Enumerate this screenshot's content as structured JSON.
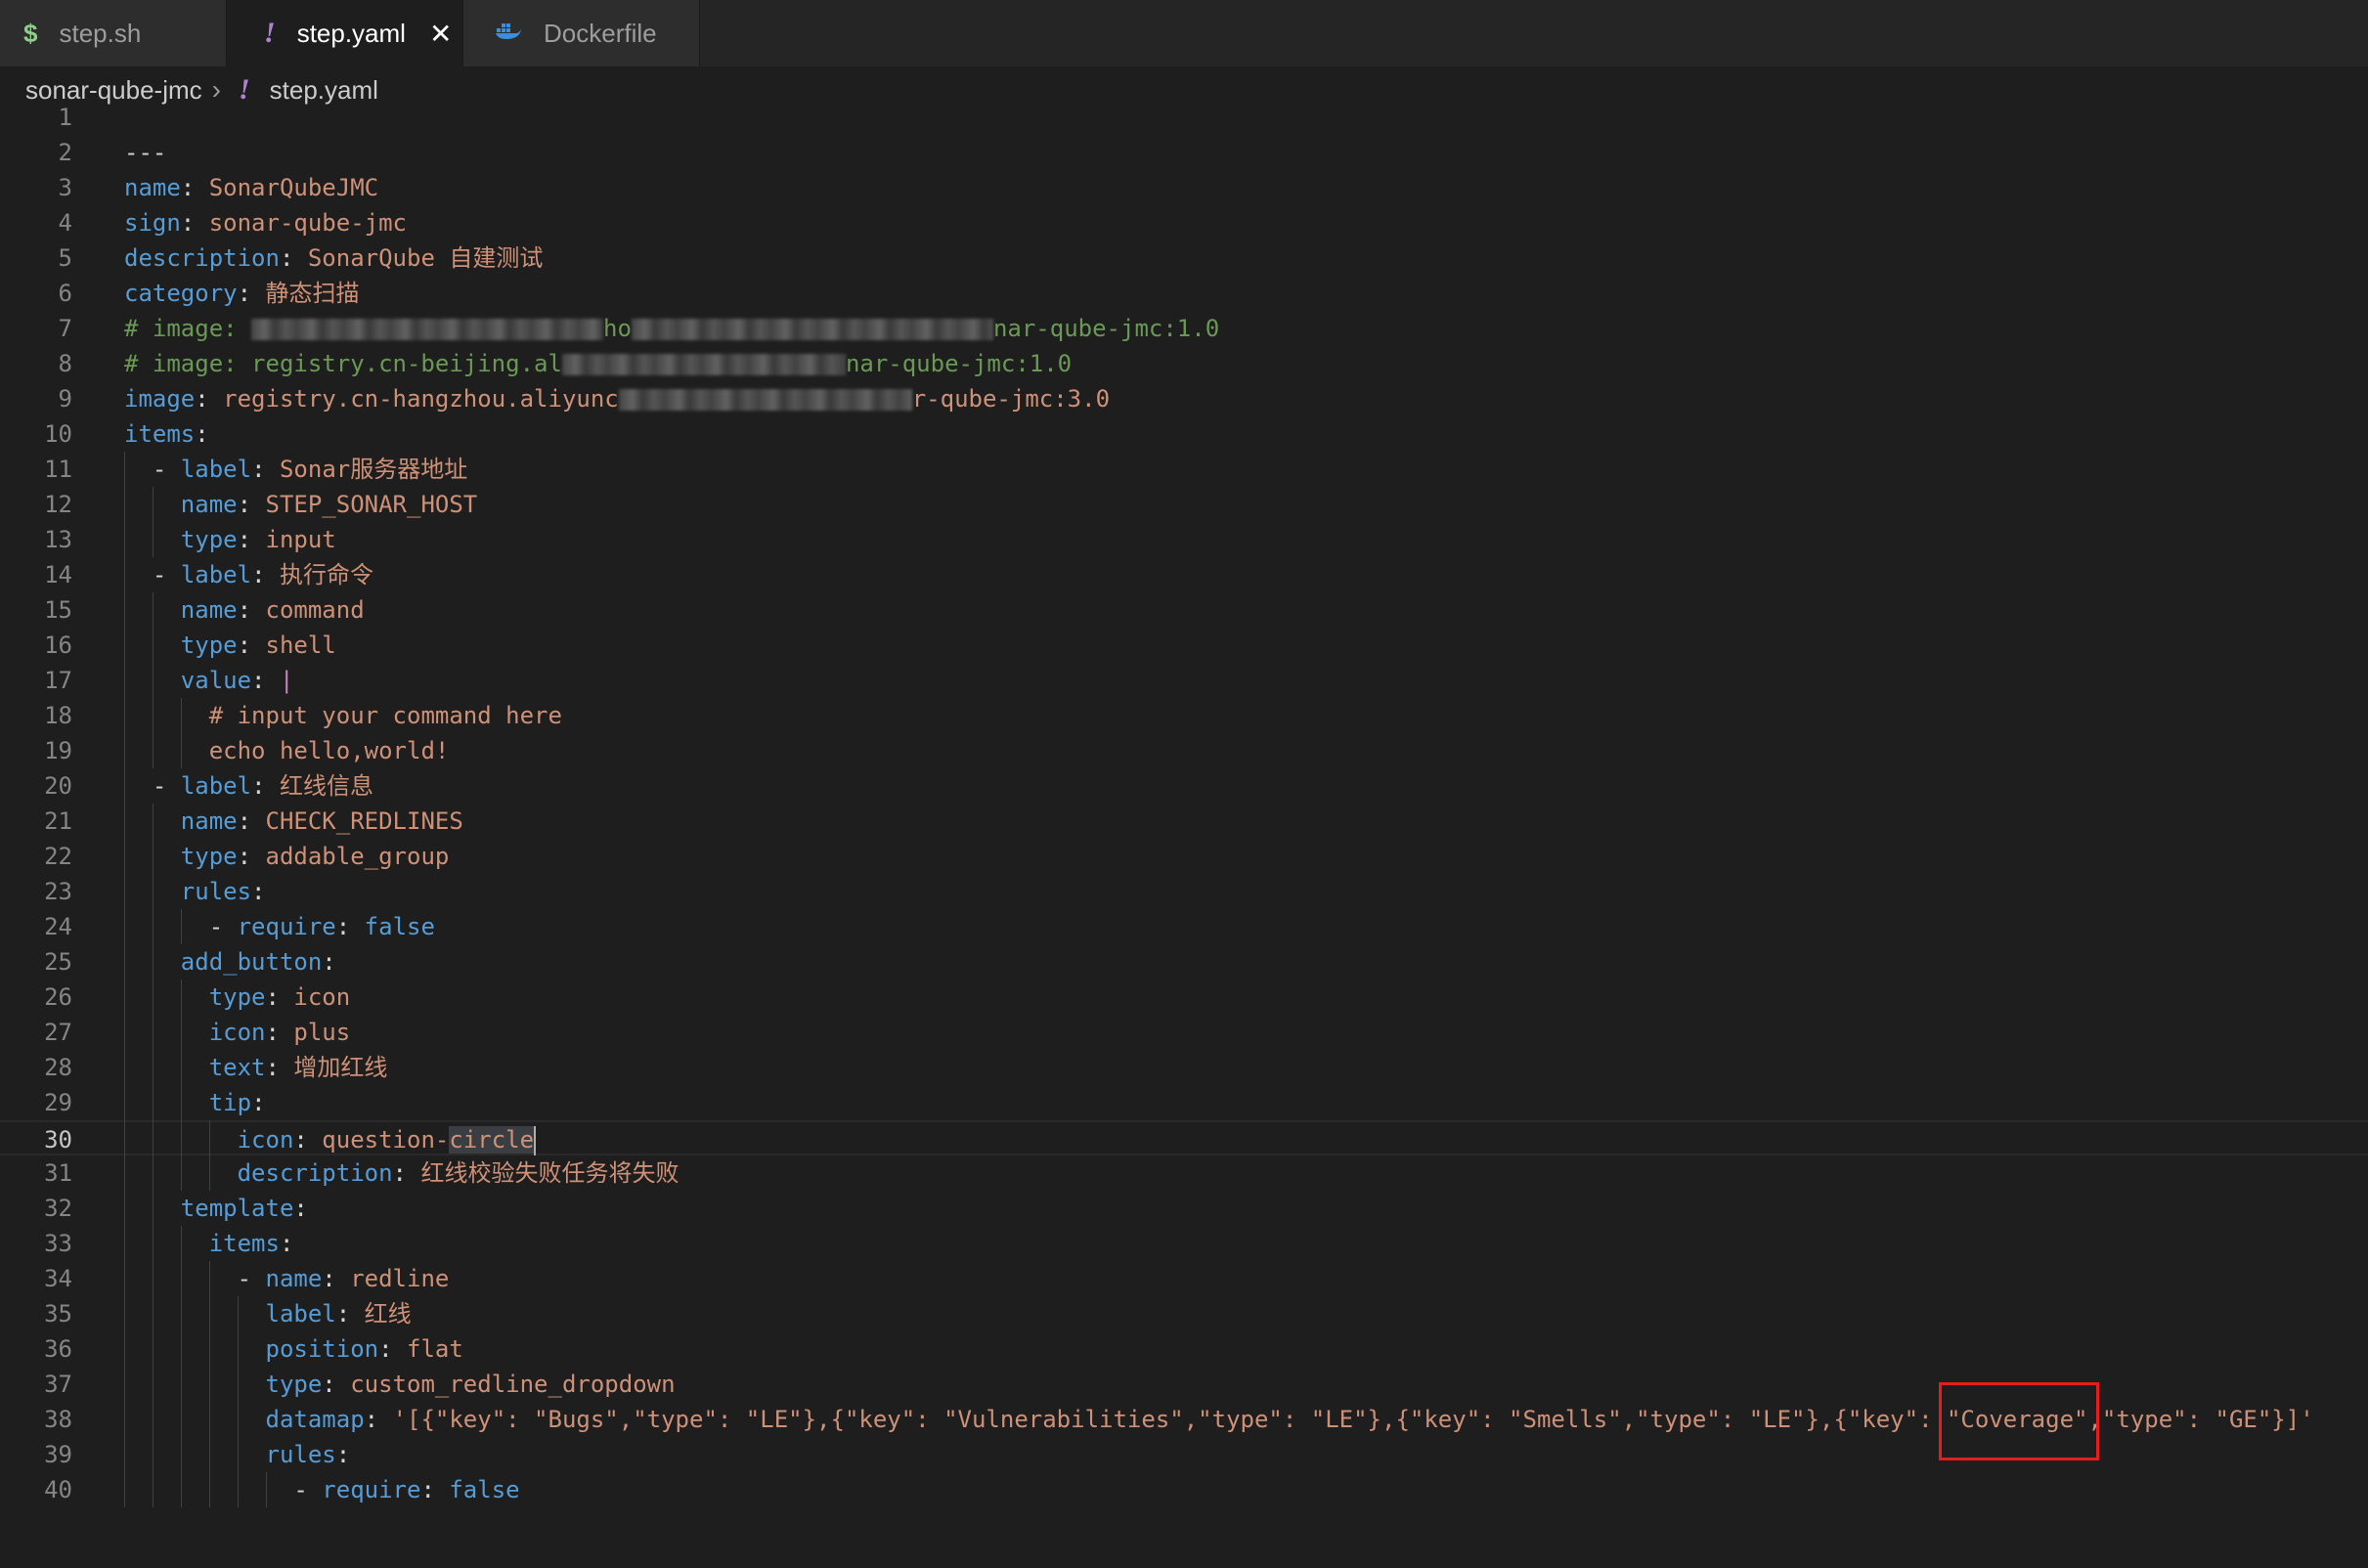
{
  "tabs": [
    {
      "label": "step.sh",
      "icon": "$",
      "active": false
    },
    {
      "label": "step.yaml",
      "icon": "!",
      "active": true
    },
    {
      "label": "Dockerfile",
      "icon": "docker-icon",
      "active": false
    }
  ],
  "close_glyph": "✕",
  "breadcrumb": {
    "folder": "sonar-qube-jmc",
    "file": "step.yaml",
    "file_icon": "!"
  },
  "current_line": 30,
  "lines": [
    "",
    "---",
    "name: SonarQubeJMC",
    "sign: sonar-qube-jmc",
    "description: SonarQube 自建测试",
    "category: 静态扫描",
    "# image: [redacted]ho[redacted]nar-qube-jmc:1.0",
    "# image: registry.cn-beijing.al[redacted]nar-qube-jmc:1.0",
    "image: registry.cn-hangzhou.aliyunc[redacted]r-qube-jmc:3.0",
    "items:",
    "  - label: Sonar服务器地址",
    "    name: STEP_SONAR_HOST",
    "    type: input",
    "  - label: 执行命令",
    "    name: command",
    "    type: shell",
    "    value: |",
    "      # input your command here",
    "      echo hello,world!",
    "  - label: 红线信息",
    "    name: CHECK_REDLINES",
    "    type: addable_group",
    "    rules:",
    "      - require: false",
    "    add_button:",
    "      type: icon",
    "      icon: plus",
    "      text: 增加红线",
    "      tip:",
    "        icon: question-circle",
    "        description: 红线校验失败任务将失败",
    "    template:",
    "      items:",
    "        - name: redline",
    "          label: 红线",
    "          position: flat",
    "          type: custom_redline_dropdown",
    "          datamap: '[{\"key\": \"Bugs\",\"type\": \"LE\"},{\"key\": \"Vulnerabilities\",\"type\": \"LE\"},{\"key\": \"Smells\",\"type\": \"LE\"},{\"key\": \"Coverage\",\"type\": \"GE\"}]'",
    "          rules:",
    "            - require: false"
  ],
  "highlight": {
    "line": 38,
    "text": "\"Coverage\"",
    "color": "#e41d1d"
  },
  "colors": {
    "key": "#569cd6",
    "string": "#ce9178",
    "comment": "#6a9955",
    "background": "#1e1e1e"
  }
}
